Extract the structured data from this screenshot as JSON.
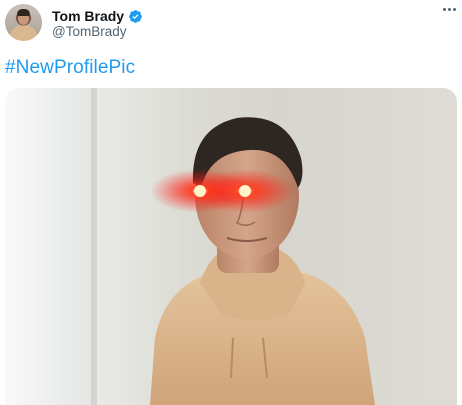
{
  "user": {
    "display_name": "Tom Brady",
    "handle": "@TomBrady",
    "verified": true
  },
  "tweet": {
    "text": "#NewProfilePic",
    "hashtag_color": "#1d9bf0"
  },
  "icons": {
    "verified": "verified-badge-icon",
    "more": "more-options-icon"
  },
  "colors": {
    "text_primary": "#0f1419",
    "text_secondary": "#536471",
    "accent": "#1d9bf0",
    "laser_eyes": "#ff2a1a"
  }
}
